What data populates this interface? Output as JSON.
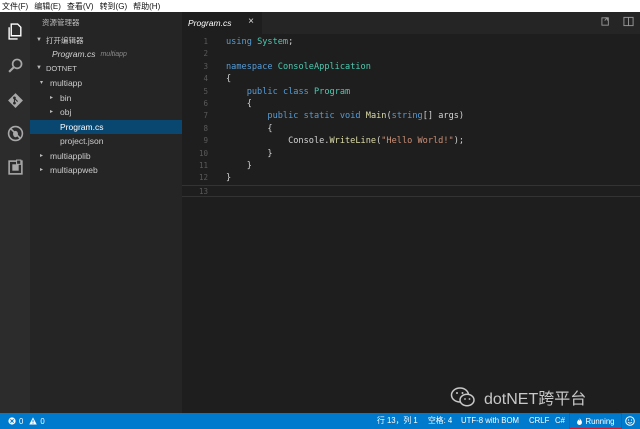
{
  "menu": [
    "文件(F)",
    "编辑(E)",
    "查看(V)",
    "转到(G)",
    "帮助(H)"
  ],
  "sidebar": {
    "title": "资源管理器",
    "open_editors_label": "打开编辑器",
    "open_file": {
      "name": "Program.cs",
      "dir": "multiapp"
    },
    "workspace_label": "DOTNET",
    "tree": [
      {
        "label": "multiapp",
        "caret": "▾",
        "indent": 1
      },
      {
        "label": "bin",
        "caret": "▸",
        "indent": 2
      },
      {
        "label": "obj",
        "caret": "▸",
        "indent": 2
      },
      {
        "label": "Program.cs",
        "caret": "",
        "indent": 2,
        "selected": true
      },
      {
        "label": "project.json",
        "caret": "",
        "indent": 2
      },
      {
        "label": "multiapplib",
        "caret": "▸",
        "indent": 1
      },
      {
        "label": "multiappweb",
        "caret": "▸",
        "indent": 1
      }
    ]
  },
  "tab": {
    "label": "Program.cs",
    "close": "×"
  },
  "editor": {
    "lines": [
      {
        "n": "1",
        "html": "<span class=\"kw\">using</span> <span class=\"ty\">System</span>;"
      },
      {
        "n": "2",
        "html": ""
      },
      {
        "n": "3",
        "html": "<span class=\"kw\">namespace</span> <span class=\"ty\">ConsoleApplication</span>"
      },
      {
        "n": "4",
        "html": "{"
      },
      {
        "n": "5",
        "html": "    <span class=\"kw\">public</span> <span class=\"kw\">class</span> <span class=\"ty\">Program</span>"
      },
      {
        "n": "6",
        "html": "    {"
      },
      {
        "n": "7",
        "html": "        <span class=\"kw\">public</span> <span class=\"kw\">static</span> <span class=\"kw\">void</span> <span class=\"fn\">Main</span>(<span class=\"kw\">string</span>[] args)"
      },
      {
        "n": "8",
        "html": "        {"
      },
      {
        "n": "9",
        "html": "            Console.<span class=\"fn\">WriteLine</span>(<span class=\"st\">\"Hello World!\"</span>);"
      },
      {
        "n": "10",
        "html": "        }"
      },
      {
        "n": "11",
        "html": "    }"
      },
      {
        "n": "12",
        "html": "}"
      },
      {
        "n": "13",
        "html": ""
      }
    ]
  },
  "watermark": "dotNET跨平台",
  "status": {
    "errors": "0",
    "warnings": "0",
    "position": "行 13，列 1",
    "spaces": "空格: 4",
    "encoding": "UTF-8 with BOM",
    "eol": "CRLF",
    "language": "C#",
    "running": "Running"
  },
  "colors": {
    "accent": "#007acc",
    "selection": "#094771",
    "highlight_border": "#e81123"
  }
}
